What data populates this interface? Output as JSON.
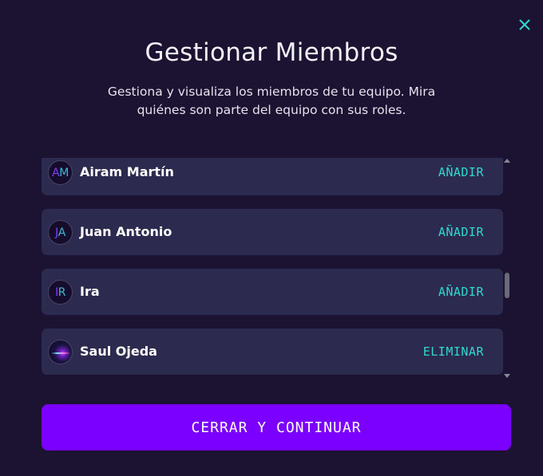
{
  "modal": {
    "title": "Gestionar Miembros",
    "subtitle": "Gestiona y visualiza los miembros de tu equipo. Mira quiénes son parte del equipo con sus roles.",
    "close_icon": "close-icon"
  },
  "members": [
    {
      "initials_a": "A",
      "initials_b": "M",
      "name": "Airam Martín",
      "action": "AÑADIR"
    },
    {
      "initials_a": "J",
      "initials_b": "A",
      "name": "Juan Antonio",
      "action": "AÑADIR"
    },
    {
      "initials_a": "I",
      "initials_b": "R",
      "name": "Ira",
      "action": "AÑADIR"
    },
    {
      "name": "Saul Ojeda",
      "action": "ELIMINAR",
      "avatar": "photo"
    }
  ],
  "footer": {
    "primary_label": "CERRAR Y CONTINUAR"
  },
  "colors": {
    "background": "#1c1232",
    "card": "#2c2a4e",
    "accent_teal": "#2fd8d0",
    "primary_button": "#7b00ff"
  }
}
